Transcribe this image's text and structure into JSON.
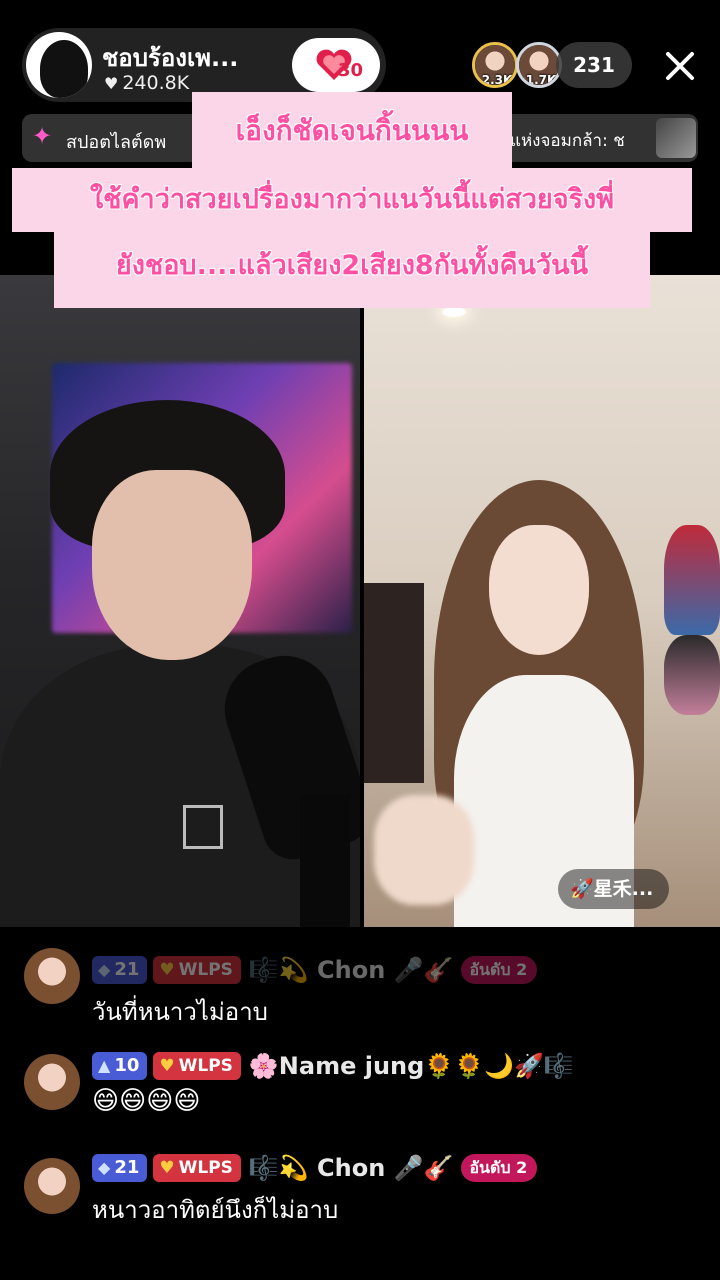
{
  "host": {
    "name": "ชอบร้องเพ...",
    "likes": "240.8K",
    "gift_count": "30"
  },
  "viewers": {
    "top1_badge": "2.3K",
    "top2_badge": "1.7K",
    "count": "231"
  },
  "spotlight": {
    "text": "สปอตไลต์ดพ",
    "right_text": "แห่งจอมกล้า: ช"
  },
  "caption": {
    "line1": "เอ็งก็ชัดเจนกิ้นนนน",
    "line2": "ใช้คำว่าสวยเปรื่องมากว่าแนวันนี้แต่สวยจริงพี่",
    "line3": "ยังชอบ....แล้วเสียง2เสียง8กันทั้งคืนวันนี้"
  },
  "guest": {
    "tag": "🚀星禾..."
  },
  "chat": [
    {
      "level": "21",
      "fan_badge": "WLPS",
      "username": "🎼💫 Chon 🎤🎸",
      "rank": "อันดับ 2",
      "text": "วันที่หนาวไม่อาบ"
    },
    {
      "level": "10",
      "fan_badge": "WLPS",
      "username": "🌸Name jung🌻🌻🌙🚀🎼",
      "rank": "",
      "text": "😄😄😄😄"
    },
    {
      "level": "21",
      "fan_badge": "WLPS",
      "username": "🎼💫 Chon 🎤🎸",
      "rank": "อันดับ 2",
      "text": "หนาวอาทิตย์นึงก็ไม่อาบ"
    }
  ],
  "colors": {
    "caption_bg": "#fbd6e8",
    "caption_text": "#ff4fa3",
    "level_badge": "#4a5bd6",
    "fan_badge": "#d3343f",
    "rank_badge": "#c2185b"
  }
}
